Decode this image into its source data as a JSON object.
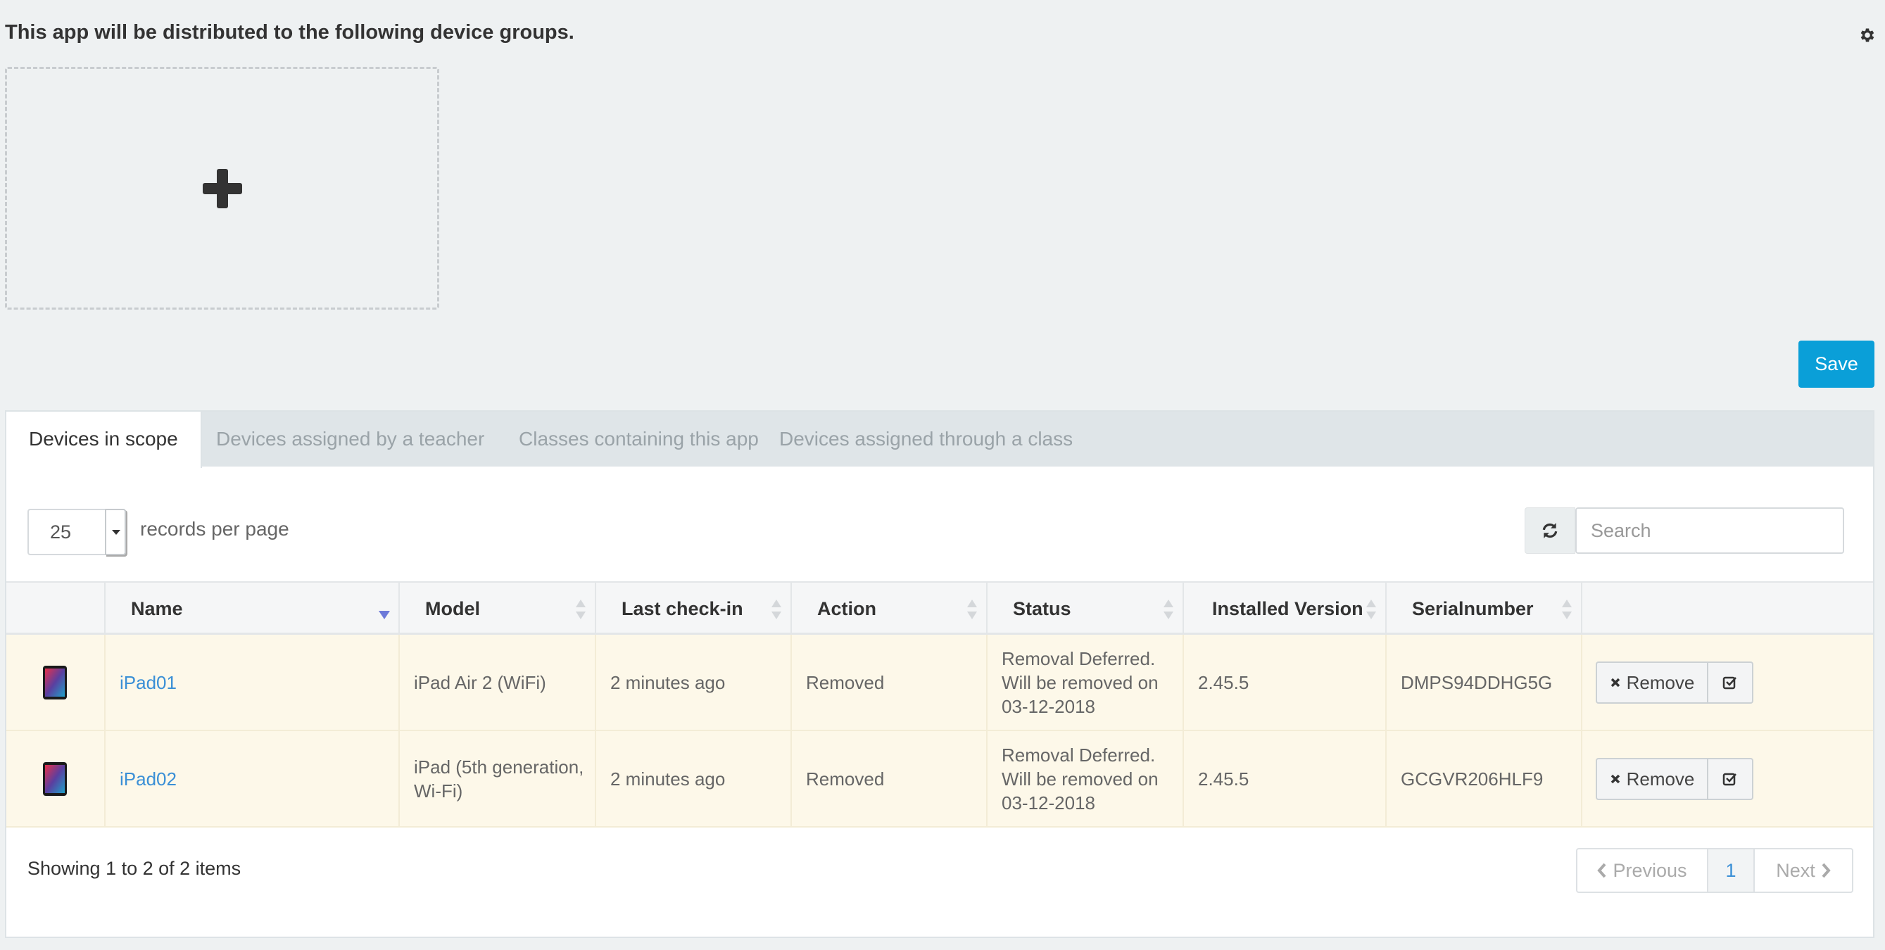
{
  "header": {
    "intro": "This app will be distributed to the following device groups.",
    "settings_icon": "gear-icon",
    "add_icon": "plus-icon"
  },
  "save_label": "Save",
  "colors": {
    "accent": "#0a9fd8",
    "link": "#3a8fd6",
    "row_highlight": "#fdf8e9"
  },
  "tabs": [
    {
      "label": "Devices in scope",
      "active": true
    },
    {
      "label": "Devices assigned by a teacher"
    },
    {
      "label": "Classes containing this app"
    },
    {
      "label": "Devices assigned through a class"
    }
  ],
  "table_controls": {
    "per_page": "25",
    "per_page_label": "records per page",
    "search_placeholder": "Search"
  },
  "columns": [
    "Name",
    "Model",
    "Last check-in",
    "Action",
    "Status",
    "Installed Version",
    "Serialnumber"
  ],
  "rows": [
    {
      "name": "iPad01",
      "model": "iPad Air 2 (WiFi)",
      "last_checkin": "2 minutes ago",
      "action": "Removed",
      "status": "Removal Deferred. Will be removed on 03-12-2018",
      "version": "2.45.5",
      "serial": "DMPS94DDHG5G",
      "remove_label": "Remove"
    },
    {
      "name": "iPad02",
      "model": "iPad (5th generation, Wi-Fi)",
      "last_checkin": "2 minutes ago",
      "action": "Removed",
      "status": "Removal Deferred. Will be removed on 03-12-2018",
      "version": "2.45.5",
      "serial": "GCGVR206HLF9",
      "remove_label": "Remove"
    }
  ],
  "footer": {
    "info": "Showing 1 to 2 of 2 items",
    "previous": "Previous",
    "current_page": "1",
    "next": "Next"
  }
}
